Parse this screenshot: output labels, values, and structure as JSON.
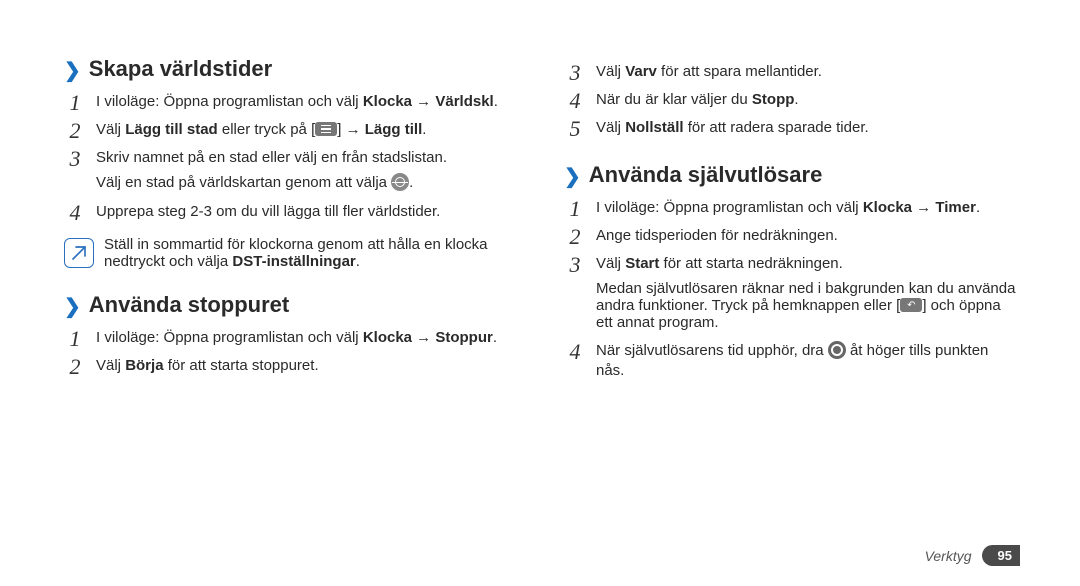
{
  "left": {
    "section1": {
      "title": "Skapa världstider",
      "steps": [
        {
          "num": "1",
          "pre": "I viloläge: Öppna programlistan och välj ",
          "b1": "Klocka",
          "mid": " → ",
          "b2": "Världskl",
          "post": "."
        },
        {
          "num": "2",
          "pre": "Välj ",
          "b1": "Lägg till stad",
          "mid_plain": " eller tryck på [",
          "menu_icon": true,
          "mid2": "] → ",
          "b2": "Lägg till",
          "post": "."
        },
        {
          "num": "3",
          "text": "Skriv namnet på en stad eller välj en från stadslistan.",
          "sub_pre": "Välj en stad på världskartan genom att välja ",
          "globe_icon": true,
          "sub_post": "."
        },
        {
          "num": "4",
          "text": "Upprepa steg 2-3 om du vill lägga till fler världstider."
        }
      ],
      "note_pre": "Ställ in sommartid för klockorna genom att hålla en klocka nedtryckt och välja ",
      "note_b": "DST-inställningar",
      "note_post": "."
    },
    "section2": {
      "title": "Använda stoppuret",
      "steps": [
        {
          "num": "1",
          "pre": "I viloläge: Öppna programlistan och välj ",
          "b1": "Klocka",
          "mid": " → ",
          "b2": "Stoppur",
          "post": "."
        },
        {
          "num": "2",
          "pre": "Välj ",
          "b1": "Börja",
          "post": " för att starta stoppuret."
        }
      ]
    }
  },
  "right": {
    "cont_steps": [
      {
        "num": "3",
        "pre": "Välj ",
        "b1": "Varv",
        "post": " för att spara mellantider."
      },
      {
        "num": "4",
        "pre": "När du är klar väljer du ",
        "b1": "Stopp",
        "post": "."
      },
      {
        "num": "5",
        "pre": "Välj ",
        "b1": "Nollställ",
        "post": " för att radera sparade tider."
      }
    ],
    "section3": {
      "title": "Använda självutlösare",
      "steps": [
        {
          "num": "1",
          "pre": "I viloläge: Öppna programlistan och välj ",
          "b1": "Klocka",
          "mid": " → ",
          "b2": "Timer",
          "post": "."
        },
        {
          "num": "2",
          "text": "Ange tidsperioden för nedräkningen."
        },
        {
          "num": "3",
          "pre": "Välj ",
          "b1": "Start",
          "post": " för att starta nedräkningen.",
          "sub": "Medan självutlösaren räknar ned i bakgrunden kan du använda andra funktioner. Tryck på hemknappen eller [",
          "return_icon": true,
          "sub2": "] och öppna ett annat program."
        },
        {
          "num": "4",
          "pre": "När självutlösarens tid upphör, dra ",
          "stop_icon": true,
          "post": " åt höger tills punkten nås."
        }
      ]
    }
  },
  "footer": {
    "label": "Verktyg",
    "page": "95"
  }
}
